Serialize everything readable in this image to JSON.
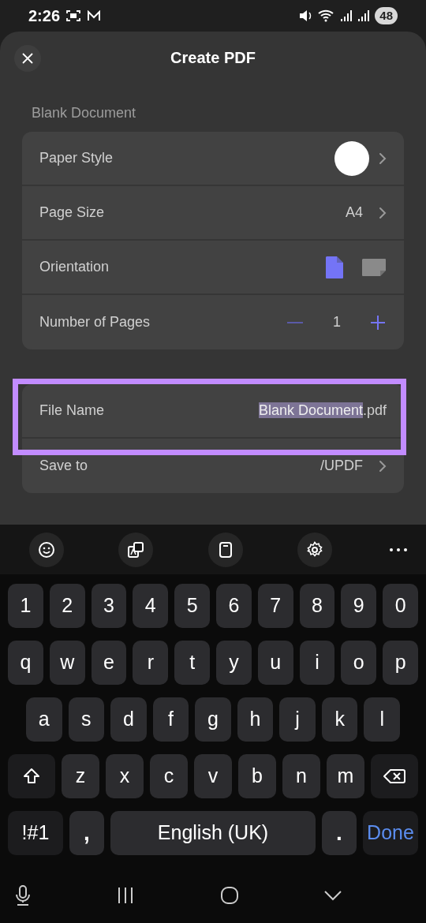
{
  "status_bar": {
    "time": "2:26",
    "battery": "48"
  },
  "header": {
    "title": "Create PDF"
  },
  "section_label": "Blank Document",
  "settings": [
    {
      "kind": "swatch",
      "label": "Paper Style",
      "color": "#ffffff"
    },
    {
      "kind": "value",
      "label": "Page Size",
      "value": "A4"
    },
    {
      "kind": "orientation",
      "label": "Orientation",
      "options": [
        {
          "kind": "portrait",
          "selected": true
        },
        {
          "kind": "landscape",
          "selected": false
        }
      ]
    },
    {
      "kind": "stepper",
      "label": "Number of Pages",
      "value": "1"
    }
  ],
  "file_name": {
    "label": "File Name",
    "value": "Blank Document",
    "extension": ".pdf",
    "highlighted": true
  },
  "save_to": {
    "label": "Save to",
    "value": "/UPDF"
  },
  "keyboard": {
    "rows": [
      {
        "keys": [
          "1",
          "2",
          "3",
          "4",
          "5",
          "6",
          "7",
          "8",
          "9",
          "0"
        ]
      },
      {
        "keys": [
          "q",
          "w",
          "e",
          "r",
          "t",
          "y",
          "u",
          "i",
          "o",
          "p"
        ]
      },
      {
        "keys": [
          "a",
          "s",
          "d",
          "f",
          "g",
          "h",
          "j",
          "k",
          "l"
        ]
      },
      {
        "keys": [
          {
            "kind": "shift"
          },
          "z",
          "x",
          "c",
          "v",
          "b",
          "n",
          "m",
          {
            "kind": "backspace"
          }
        ]
      },
      {
        "keys": [
          {
            "kind": "symbols",
            "label": "!#1"
          },
          {
            "kind": "punct",
            "label": ","
          },
          {
            "kind": "space",
            "label": "English (UK)"
          },
          {
            "kind": "punct",
            "label": "."
          },
          {
            "kind": "done",
            "label": "Done"
          }
        ]
      }
    ]
  }
}
